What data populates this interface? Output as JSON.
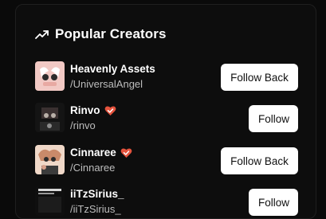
{
  "section": {
    "title": "Popular Creators",
    "icon": "trending-up-icon"
  },
  "creators": [
    {
      "name": "Heavenly Assets",
      "handle": "/UniversalAngel",
      "button": "Follow Back",
      "verified": false
    },
    {
      "name": "Rinvo",
      "handle": "/rinvo",
      "button": "Follow",
      "verified": true
    },
    {
      "name": "Cinnaree",
      "handle": "/Cinnaree",
      "button": "Follow Back",
      "verified": true
    },
    {
      "name": "iiTzSirius_",
      "handle": "/iiTzSirius_",
      "button": "Follow",
      "verified": false
    }
  ],
  "colors": {
    "background": "#0a0a0a",
    "card": "#0d0d0d",
    "button_bg": "#ffffff",
    "button_text": "#111111",
    "handle_text": "#bdbdbd",
    "verified_badge": "#e5533d"
  }
}
